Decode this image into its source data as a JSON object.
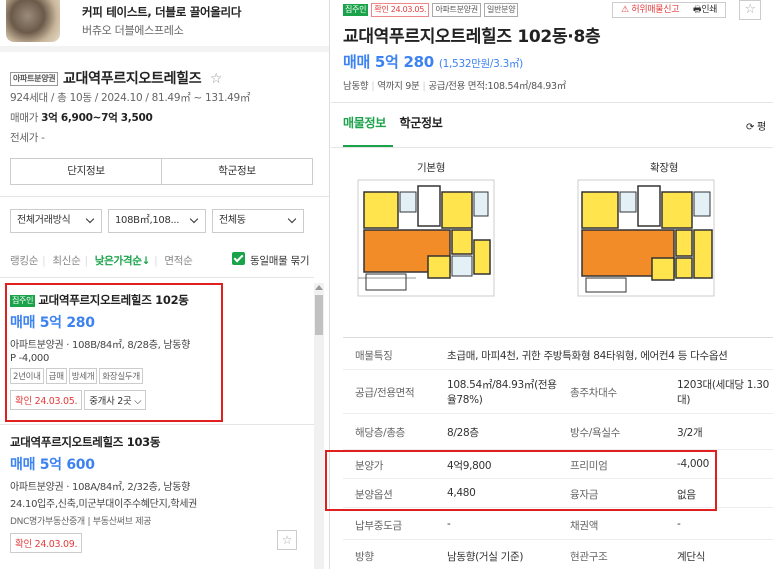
{
  "ad": {
    "title": "커피 테이스트, 더블로 끌어올리다",
    "subtitle": "버츄오 더블에스프레소"
  },
  "complex": {
    "tag": "아파트분양권",
    "name": "교대역푸르지오트레힐즈",
    "meta": "924세대 / 총 10동 / 2024.10 / 81.49㎡ ~ 131.49㎡",
    "price_label": "매매가",
    "price_value": "3억 6,900~7억 3,500",
    "lease": "전세가 -",
    "tabs": [
      "단지정보",
      "학군정보"
    ]
  },
  "filters": [
    {
      "label": "전체거래방식"
    },
    {
      "label": "108B㎡,108..."
    },
    {
      "label": "전체동"
    }
  ],
  "sort": {
    "items": [
      "랭킹순",
      "최신순",
      "낮은가격순↓",
      "면적순"
    ],
    "checkbox_label": "동일매물 묶기"
  },
  "listings": [
    {
      "tag": "집주인",
      "name": "교대역푸르지오트레힐즈 102동",
      "price": "매매 5억 280",
      "info": "아파트분양권 · 108B/84㎡, 8/28층, 남동향",
      "info2": "P -4,000",
      "chips": [
        "2년이내",
        "급매",
        "방세개",
        "화장실두개"
      ],
      "confirm": "확인 24.03.05.",
      "agent": "중개사 2곳"
    },
    {
      "name": "교대역푸르지오트레힐즈 103동",
      "price": "매매 5억 600",
      "info": "아파트분양권 · 108A/84㎡, 2/32층, 남동향",
      "info2": "24.10입주,신축,미군부대이주수혜단지,학세권",
      "source": "DNC명가부동산중개 | 부동산써브 제공",
      "confirm": "확인 24.03.09."
    }
  ],
  "detail": {
    "tags": [
      "집주인",
      "확인 24.03.05.",
      "아파트분양권",
      "일반분양"
    ],
    "report": "허위매물신고",
    "print": "인쇄",
    "title": "교대역푸르지오트레힐즈 102동·8층",
    "price": "매매 5억 280",
    "price_per": "(1,532만원/3.3㎡)",
    "sub": [
      "남동향",
      "역까지 9분",
      "공급/전용 면적:108.54㎡/84.93㎡"
    ],
    "tabs": [
      "매물정보",
      "학군정보"
    ],
    "tab_right": "평",
    "floorplans": [
      "기본형",
      "확장형"
    ],
    "rows": [
      {
        "k1": "매물특징",
        "v1": "초급매, 마피4천, 귀한 주방특화형 84타워형, 에어컨4 등 다수옵션"
      },
      {
        "k1": "공급/전용면적",
        "v1": "108.54㎡/84.93㎡(전용율78%)",
        "k2": "총주차대수",
        "v2": "1203대(세대당 1.30대)"
      },
      {
        "k1": "해당층/총층",
        "v1": "8/28층",
        "k2": "방수/욕실수",
        "v2": "3/2개"
      },
      {
        "k1": "분양가",
        "v1": "4억9,800",
        "k2": "프리미엄",
        "v2": "-4,000"
      },
      {
        "k1": "분양옵션",
        "v1": "4,480",
        "k2": "융자금",
        "v2": "없음"
      },
      {
        "k1": "납부중도금",
        "v1": "-",
        "k2": "채권액",
        "v2": "-"
      },
      {
        "k1": "방향",
        "v1": "남동향(거실 기준)",
        "k2": "현관구조",
        "v2": "계단식"
      }
    ]
  },
  "colors": {
    "green": "#1aa34a",
    "blue": "#3c82f0",
    "red": "#e01f1f"
  }
}
